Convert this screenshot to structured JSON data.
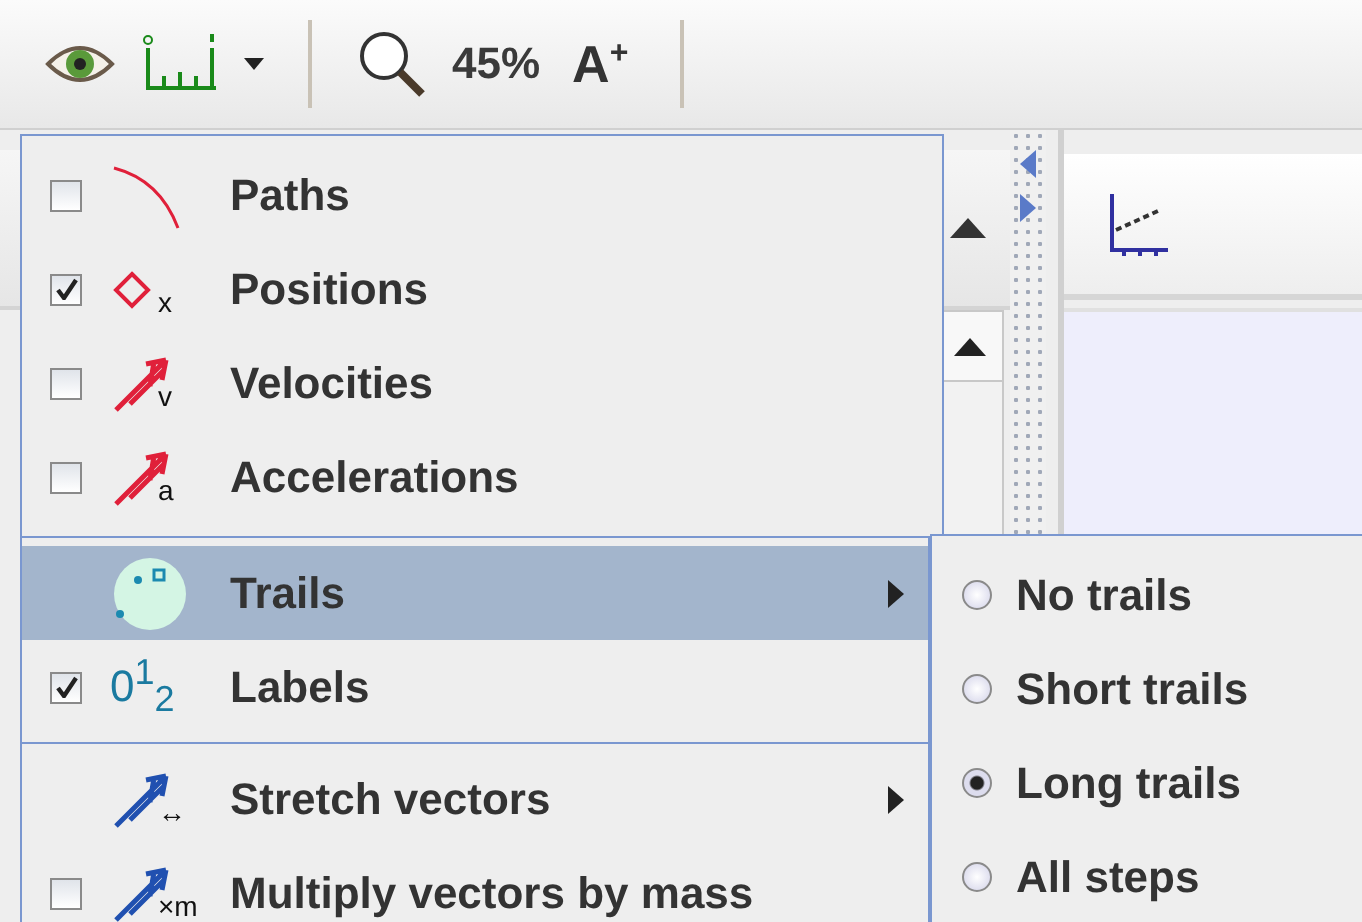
{
  "toolbar": {
    "zoom": "45%",
    "font_button": "A$^{+}$"
  },
  "menu": {
    "sections": [
      [
        {
          "kind": "check",
          "label": "Paths",
          "checked": false
        },
        {
          "kind": "check",
          "label": "Positions",
          "checked": true,
          "icon_mark": "x"
        },
        {
          "kind": "check",
          "label": "Velocities",
          "checked": false,
          "icon_mark": "v"
        },
        {
          "kind": "check",
          "label": "Accelerations",
          "checked": false,
          "icon_mark": "a"
        }
      ],
      [
        {
          "kind": "submenu",
          "label": "Trails",
          "selected": true
        },
        {
          "kind": "check",
          "label": "Labels",
          "checked": true,
          "icon_text": "0$^{1}$$_{2}$"
        }
      ],
      [
        {
          "kind": "submenu",
          "label": "Stretch vectors",
          "selected": false,
          "icon_mark": "↔"
        },
        {
          "kind": "check",
          "label": "Multiply vectors by mass",
          "checked": false,
          "icon_mark": "×m"
        }
      ]
    ]
  },
  "submenu": {
    "items": [
      {
        "label": "No trails",
        "selected": false
      },
      {
        "label": "Short trails",
        "selected": false
      },
      {
        "label": "Long trails",
        "selected": true
      },
      {
        "label": "All steps",
        "selected": false
      }
    ]
  }
}
